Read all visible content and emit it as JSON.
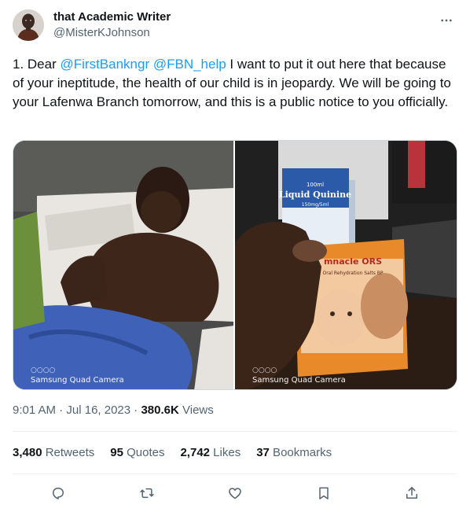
{
  "author": {
    "display_name": "that Academic Writer",
    "handle": "@MisterKJohnson"
  },
  "tweet": {
    "text_parts": {
      "prefix": "1. Dear ",
      "mention1": "@FirstBankngr",
      "space": " ",
      "mention2": "@FBN_help",
      "body": " I want to put it out here that because of your ineptitude, the health of our child is in jeopardy. We will be going to your Lafenwa Branch tomorrow, and this is a public notice to you officially."
    },
    "media": [
      {
        "watermark_circles": "○○○○",
        "watermark": "Samsung Quad Camera"
      },
      {
        "watermark_circles": "○○○○",
        "watermark": "Samsung Quad Camera",
        "product_1_name": "Liquid Quinine",
        "product_1_volume": "100ml",
        "product_1_dose": "150mg/5ml",
        "product_2_name": "mnacle ORS",
        "product_2_sub": "Oral Rehydration Salts BP"
      }
    ]
  },
  "meta": {
    "time": "9:01 AM",
    "sep1": " · ",
    "date": "Jul 16, 2023",
    "sep2": " · ",
    "views_count": "380.6K",
    "views_label": " Views"
  },
  "stats": {
    "retweets_count": "3,480",
    "retweets_label": " Retweets",
    "quotes_count": "95",
    "quotes_label": " Quotes",
    "likes_count": "2,742",
    "likes_label": " Likes",
    "bookmarks_count": "37",
    "bookmarks_label": " Bookmarks"
  },
  "colors": {
    "link": "#1d9bf0",
    "secondary_text": "#536471",
    "primary_text": "#0f1419"
  },
  "icons": [
    "more-icon",
    "reply-icon",
    "retweet-icon",
    "like-icon",
    "bookmark-icon",
    "share-icon"
  ]
}
